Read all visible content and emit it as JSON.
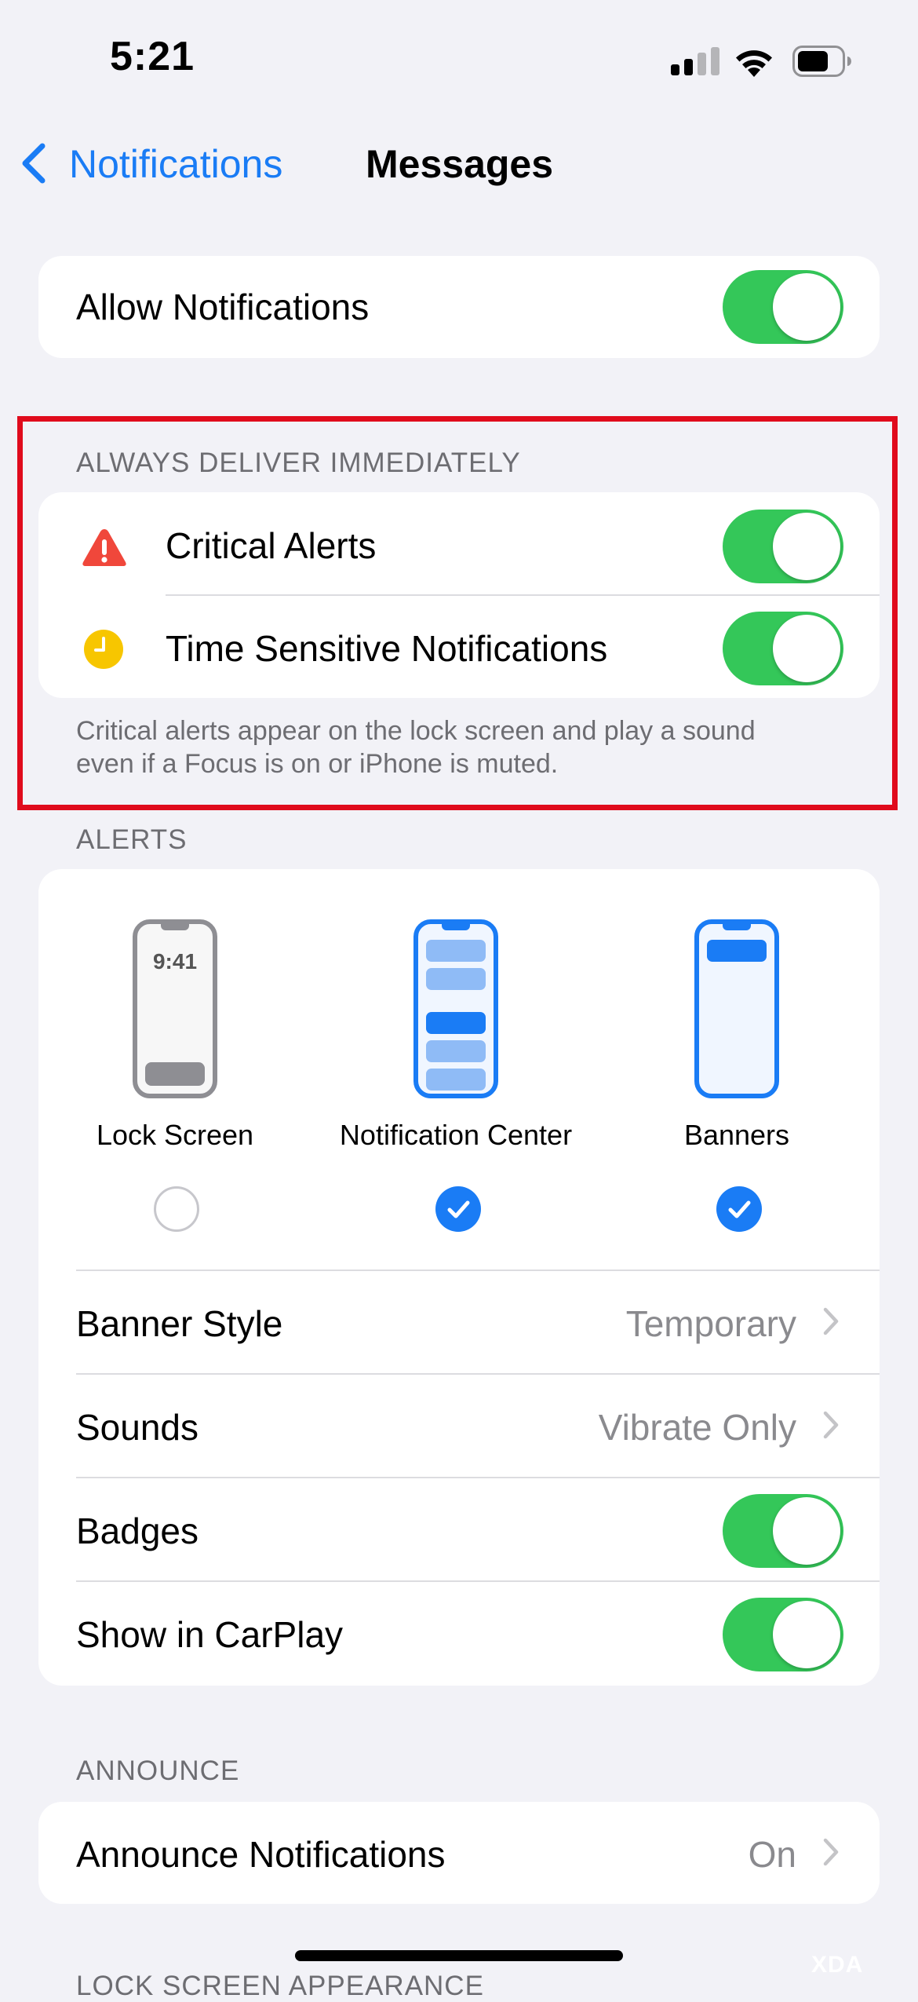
{
  "status_bar": {
    "time": "5:21"
  },
  "nav": {
    "back_label": "Notifications",
    "title": "Messages"
  },
  "allow": {
    "label": "Allow Notifications",
    "on": true
  },
  "deliver": {
    "header": "ALWAYS DELIVER IMMEDIATELY",
    "critical_label": "Critical Alerts",
    "time_sensitive_label": "Time Sensitive Notifications",
    "footer_line1": "Critical alerts appear on the lock screen and play a sound",
    "footer_line2": "even if a Focus is on or iPhone is muted."
  },
  "alerts": {
    "header": "ALERTS",
    "lock_screen_time": "9:41",
    "options": [
      {
        "label": "Lock Screen",
        "checked": false
      },
      {
        "label": "Notification Center",
        "checked": true
      },
      {
        "label": "Banners",
        "checked": true
      }
    ],
    "banner_style": {
      "label": "Banner Style",
      "value": "Temporary"
    },
    "sounds": {
      "label": "Sounds",
      "value": "Vibrate Only"
    },
    "badges": {
      "label": "Badges",
      "on": true
    },
    "carplay": {
      "label": "Show in CarPlay",
      "on": true
    }
  },
  "announce": {
    "header": "ANNOUNCE",
    "label": "Announce Notifications",
    "value": "On"
  },
  "lock_screen_appearance": {
    "header": "LOCK SCREEN APPEARANCE"
  },
  "watermark": "XDA",
  "colors": {
    "accent": "#1a7cf5",
    "toggle_on": "#34c759",
    "critical_icon": "#f0473b",
    "time_sensitive_icon": "#f7c600",
    "highlight_border": "#e00b1c"
  }
}
